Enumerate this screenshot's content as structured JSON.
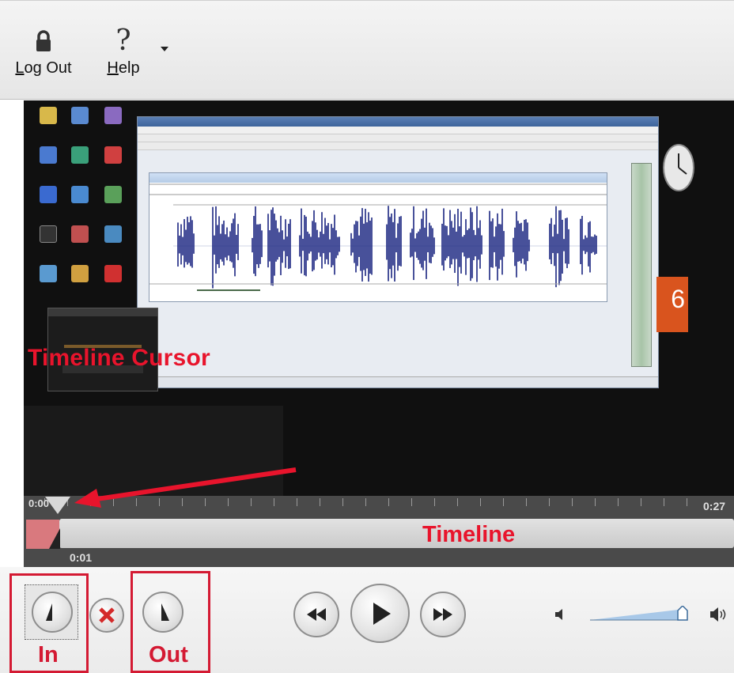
{
  "toolbar": {
    "logout": {
      "label_prefix": "",
      "label_underline": "L",
      "label_rest": "og Out",
      "icon": "lock-icon"
    },
    "help": {
      "glyph": "?",
      "label_underline": "H",
      "label_rest": "elp",
      "icon": "question-icon"
    },
    "dropdown_icon": "chevron-down-icon"
  },
  "video": {
    "wave_color": "#1a2580",
    "tile_text": "6"
  },
  "annotations": {
    "cursor_label": "Timeline Cursor",
    "timeline_label": "Timeline",
    "in_label": "In",
    "out_label": "Out",
    "color": "#e8142c"
  },
  "ruler": {
    "start_time": "0:00",
    "end_time": "0:27"
  },
  "timeline": {
    "current_time": "0:01",
    "selection_color": "#d9797e"
  },
  "controls": {
    "in_button": "mark-in-icon",
    "clear_button": "clear-x-icon",
    "out_button": "mark-out-icon",
    "rewind_button": "rewind-icon",
    "play_button": "play-icon",
    "forward_button": "fast-forward-icon",
    "volume_level": 0.9
  }
}
